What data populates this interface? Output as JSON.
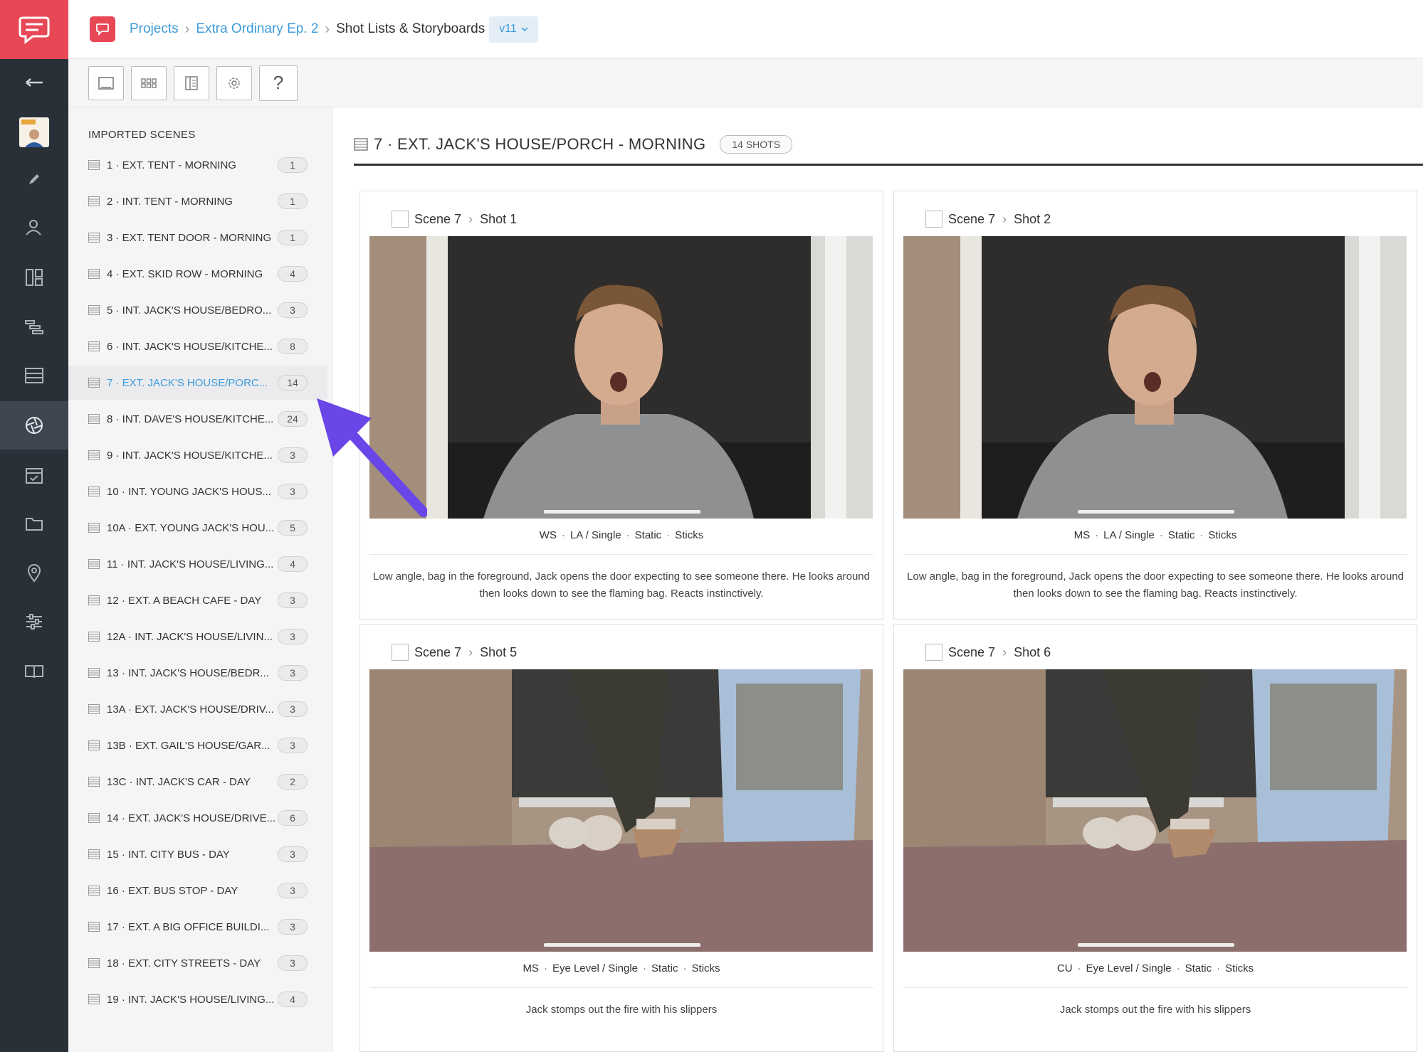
{
  "topbar": {
    "crumbs": [
      "Projects",
      "Extra Ordinary Ep. 2"
    ],
    "current": "Shot Lists & Storyboards",
    "version": "v11"
  },
  "rail": {
    "icons": [
      "back-arrow-icon",
      "project-thumbnail",
      "pencil-icon",
      "people-icon",
      "storyboard-icon",
      "stripboard-icon",
      "shotlist-icon",
      "aperture-icon",
      "calendar-icon",
      "folder-icon",
      "location-pin-icon",
      "sliders-icon",
      "book-icon"
    ]
  },
  "toolbar": {
    "help": "?"
  },
  "scenes": {
    "heading": "IMPORTED SCENES",
    "items": [
      {
        "label": "1 · EXT. TENT - MORNING",
        "count": "1"
      },
      {
        "label": "2 · INT. TENT - MORNING",
        "count": "1"
      },
      {
        "label": "3 · EXT. TENT DOOR - MORNING",
        "count": "1"
      },
      {
        "label": "4 · EXT. SKID ROW - MORNING",
        "count": "4"
      },
      {
        "label": "5 · INT. JACK'S HOUSE/BEDRO...",
        "count": "3"
      },
      {
        "label": "6 · INT. JACK'S HOUSE/KITCHE...",
        "count": "8"
      },
      {
        "label": "7 · EXT. JACK'S HOUSE/PORC...",
        "count": "14"
      },
      {
        "label": "8 · INT. DAVE'S HOUSE/KITCHE...",
        "count": "24"
      },
      {
        "label": "9 · INT. JACK'S HOUSE/KITCHE...",
        "count": "3"
      },
      {
        "label": "10 · INT. YOUNG JACK'S HOUS...",
        "count": "3"
      },
      {
        "label": "10A · EXT. YOUNG JACK'S HOU...",
        "count": "5"
      },
      {
        "label": "11 · INT. JACK'S HOUSE/LIVING...",
        "count": "4"
      },
      {
        "label": "12 · EXT. A BEACH CAFE - DAY",
        "count": "3"
      },
      {
        "label": "12A · INT. JACK'S HOUSE/LIVIN...",
        "count": "3"
      },
      {
        "label": "13 · INT. JACK'S HOUSE/BEDR...",
        "count": "3"
      },
      {
        "label": "13A · EXT. JACK'S HOUSE/DRIV...",
        "count": "3"
      },
      {
        "label": "13B · EXT. GAIL'S HOUSE/GAR...",
        "count": "3"
      },
      {
        "label": "13C · INT. JACK'S CAR - DAY",
        "count": "2"
      },
      {
        "label": "14 · EXT. JACK'S HOUSE/DRIVE...",
        "count": "6"
      },
      {
        "label": "15 · INT. CITY BUS - DAY",
        "count": "3"
      },
      {
        "label": "16 · EXT. BUS STOP - DAY",
        "count": "3"
      },
      {
        "label": "17 · EXT. A BIG OFFICE BUILDI...",
        "count": "3"
      },
      {
        "label": "18 · EXT. CITY STREETS - DAY",
        "count": "3"
      },
      {
        "label": "19 · INT. JACK'S HOUSE/LIVING...",
        "count": "4"
      }
    ]
  },
  "main": {
    "title": "7 · EXT. JACK'S HOUSE/PORCH - MORNING",
    "badge": "14 SHOTS",
    "cards": [
      {
        "scene": "Scene 7",
        "shot": "Shot 1",
        "size": "WS",
        "angle": "LA / Single",
        "movement": "Static",
        "equipment": "Sticks",
        "desc": "Low angle, bag in the foreground, Jack opens the door expecting to see someone there. He looks around then looks down to see the flaming bag. Reacts instinctively."
      },
      {
        "scene": "Scene 7",
        "shot": "Shot 2",
        "size": "MS",
        "angle": "LA / Single",
        "movement": "Static",
        "equipment": "Sticks",
        "desc": "Low angle, bag in the foreground, Jack opens the door expecting to see someone there. He looks around then looks down to see the flaming bag. Reacts instinctively."
      },
      {
        "scene": "Scene 7",
        "shot": "Shot 5",
        "size": "MS",
        "angle": "Eye Level / Single",
        "movement": "Static",
        "equipment": "Sticks",
        "desc": "Jack stomps out the fire with his slippers"
      },
      {
        "scene": "Scene 7",
        "shot": "Shot 6",
        "size": "CU",
        "angle": "Eye Level / Single",
        "movement": "Static",
        "equipment": "Sticks",
        "desc": "Jack stomps out the fire with his slippers"
      }
    ]
  },
  "colors": {
    "brand": "#e84855",
    "link": "#3d9cdc",
    "rail": "#2a3038",
    "arrow": "#6a45e8"
  }
}
